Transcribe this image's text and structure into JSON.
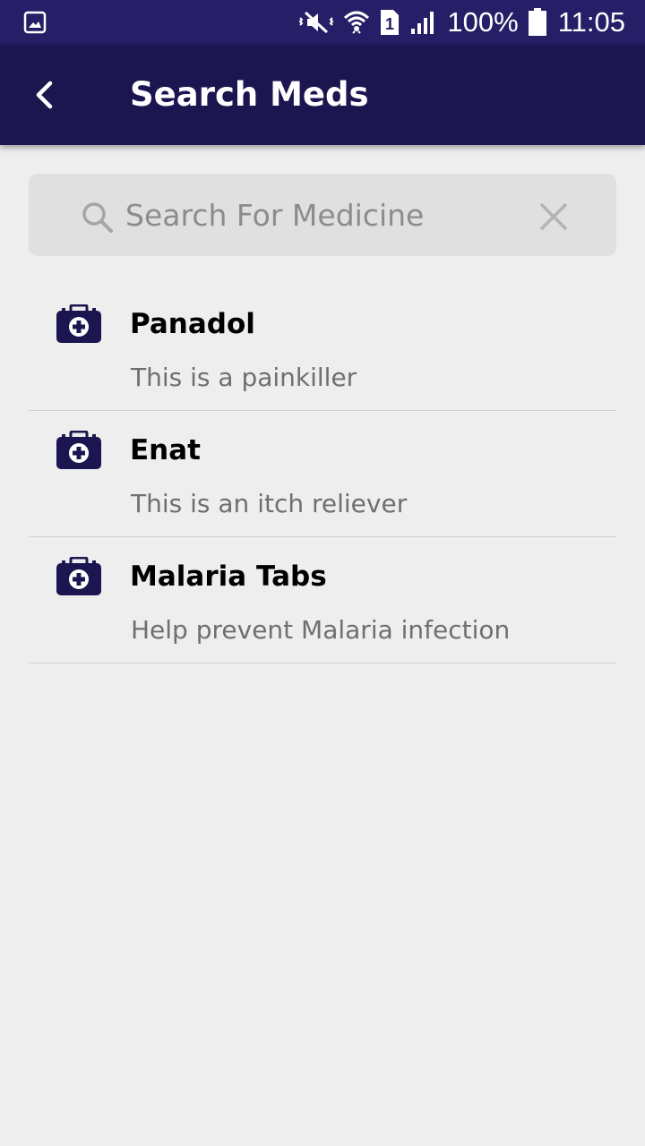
{
  "status_bar": {
    "battery_text": "100%",
    "time": "11:05",
    "sim_slot": "1",
    "icons": [
      "gallery-icon",
      "mute-vibrate-icon",
      "wifi-icon",
      "sim-icon",
      "signal-icon",
      "battery-icon"
    ]
  },
  "app_bar": {
    "title": "Search Meds",
    "back_icon": "chevron-left-icon"
  },
  "search": {
    "placeholder": "Search For Medicine",
    "value": "",
    "search_icon": "search-icon",
    "clear_icon": "close-icon"
  },
  "meds": [
    {
      "name": "Panadol",
      "description": "This is a painkiller",
      "icon": "medical-kit-icon"
    },
    {
      "name": "Enat",
      "description": "This is an itch reliever",
      "icon": "medical-kit-icon"
    },
    {
      "name": "Malaria Tabs",
      "description": "Help prevent Malaria infection",
      "icon": "medical-kit-icon"
    }
  ],
  "colors": {
    "status_bar_bg": "#261e66",
    "app_bar_bg": "#1c1650",
    "page_bg": "#eeeeee",
    "search_bg": "#e0e0e0",
    "icon_color": "#1c1650",
    "description_text": "#6f6f6f"
  }
}
